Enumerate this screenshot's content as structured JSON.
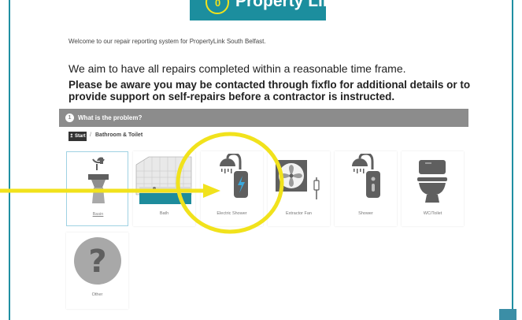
{
  "header": {
    "logo_badge": "0",
    "logo_text": "Property Link"
  },
  "intro": {
    "welcome": "Welcome to our repair reporting system for PropertyLink South Belfast.",
    "aim": "We aim to have all repairs completed within a reasonable time frame.",
    "aware": "Please be aware you may be contacted through fixflo for additional details or to provide support on self-repairs before a contractor is instructed."
  },
  "question": {
    "number": "1",
    "text": "What is the problem?"
  },
  "breadcrumb": {
    "start_label": "↥ Start",
    "separator": "/",
    "current": "Bathroom & Toilet"
  },
  "tiles": [
    {
      "label": "Basin",
      "icon": "basin-icon",
      "selected": true
    },
    {
      "label": "Bath",
      "icon": "bath-icon"
    },
    {
      "label": "Electric Shower",
      "icon": "electric-shower-icon"
    },
    {
      "label": "Extractor Fan",
      "icon": "extractor-fan-icon"
    },
    {
      "label": "Shower",
      "icon": "shower-icon"
    },
    {
      "label": "WC/Toilet",
      "icon": "toilet-icon"
    },
    {
      "label": "Other",
      "icon": "question-icon"
    }
  ],
  "colors": {
    "brand": "#1c8e9e",
    "accent_yellow": "#f1e21c",
    "icon_grey": "#5f5f5f",
    "bar_grey": "#8c8c8c",
    "highlight_blue": "#3aa8dc"
  }
}
